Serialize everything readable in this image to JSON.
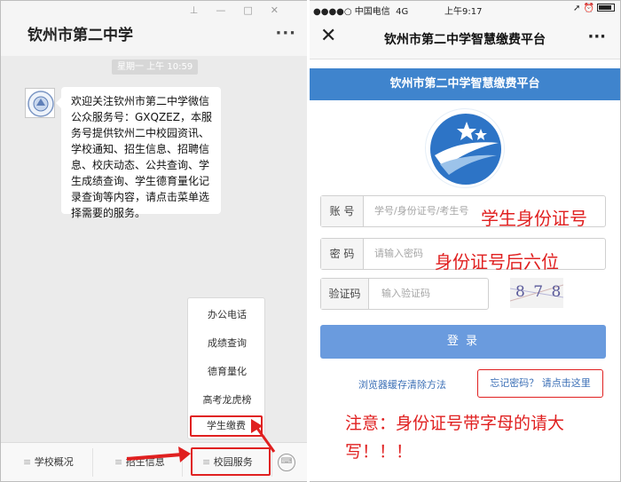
{
  "left": {
    "title": "钦州市第二中学",
    "time_label": "星期一 上午 10:59",
    "message": "欢迎关注钦州市第二中学微信公众服务号：GXQZEZ，本服务号提供钦州二中校园资讯、学校通知、招生信息、招聘信息、校庆动态、公共查询、学生成绩查询、学生德育量化记录查询等内容，请点击菜单选择需要的服务。",
    "popup_items": [
      "办公电话",
      "成绩查询",
      "德育量化",
      "高考龙虎榜",
      "学生缴费"
    ],
    "bottom_menu": [
      "学校概况",
      "招生信息",
      "校园服务"
    ],
    "colors": {
      "highlight": "#e02020",
      "chat_bg": "#ebebeb"
    }
  },
  "right": {
    "status": {
      "carrier": "●●●●○ 中国电信",
      "network": "4G",
      "time": "上午9:17"
    },
    "nav_title": "钦州市第二中学智慧缴费平台",
    "header_title": "钦州市第二中学智慧缴费平台",
    "account_label": "账 号",
    "account_placeholder": "学号/身份证号/考生号",
    "account_hint": "学生身份证号",
    "password_label": "密 码",
    "password_placeholder": "请输入密码",
    "password_hint": "身份证号后六位",
    "captcha_label": "验证码",
    "captcha_placeholder": "输入验证码",
    "captcha_text": "8 7 8",
    "login_label": "登 录",
    "cache_link": "浏览器缓存清除方法",
    "forgot_link": "忘记密码？ 请点击这里",
    "notice": "注意：身份证号带字母的请大写！！！",
    "colors": {
      "header": "#3f84cd",
      "button": "#6a9bde",
      "link": "#3b6fb6",
      "annotation": "#e02020"
    }
  }
}
